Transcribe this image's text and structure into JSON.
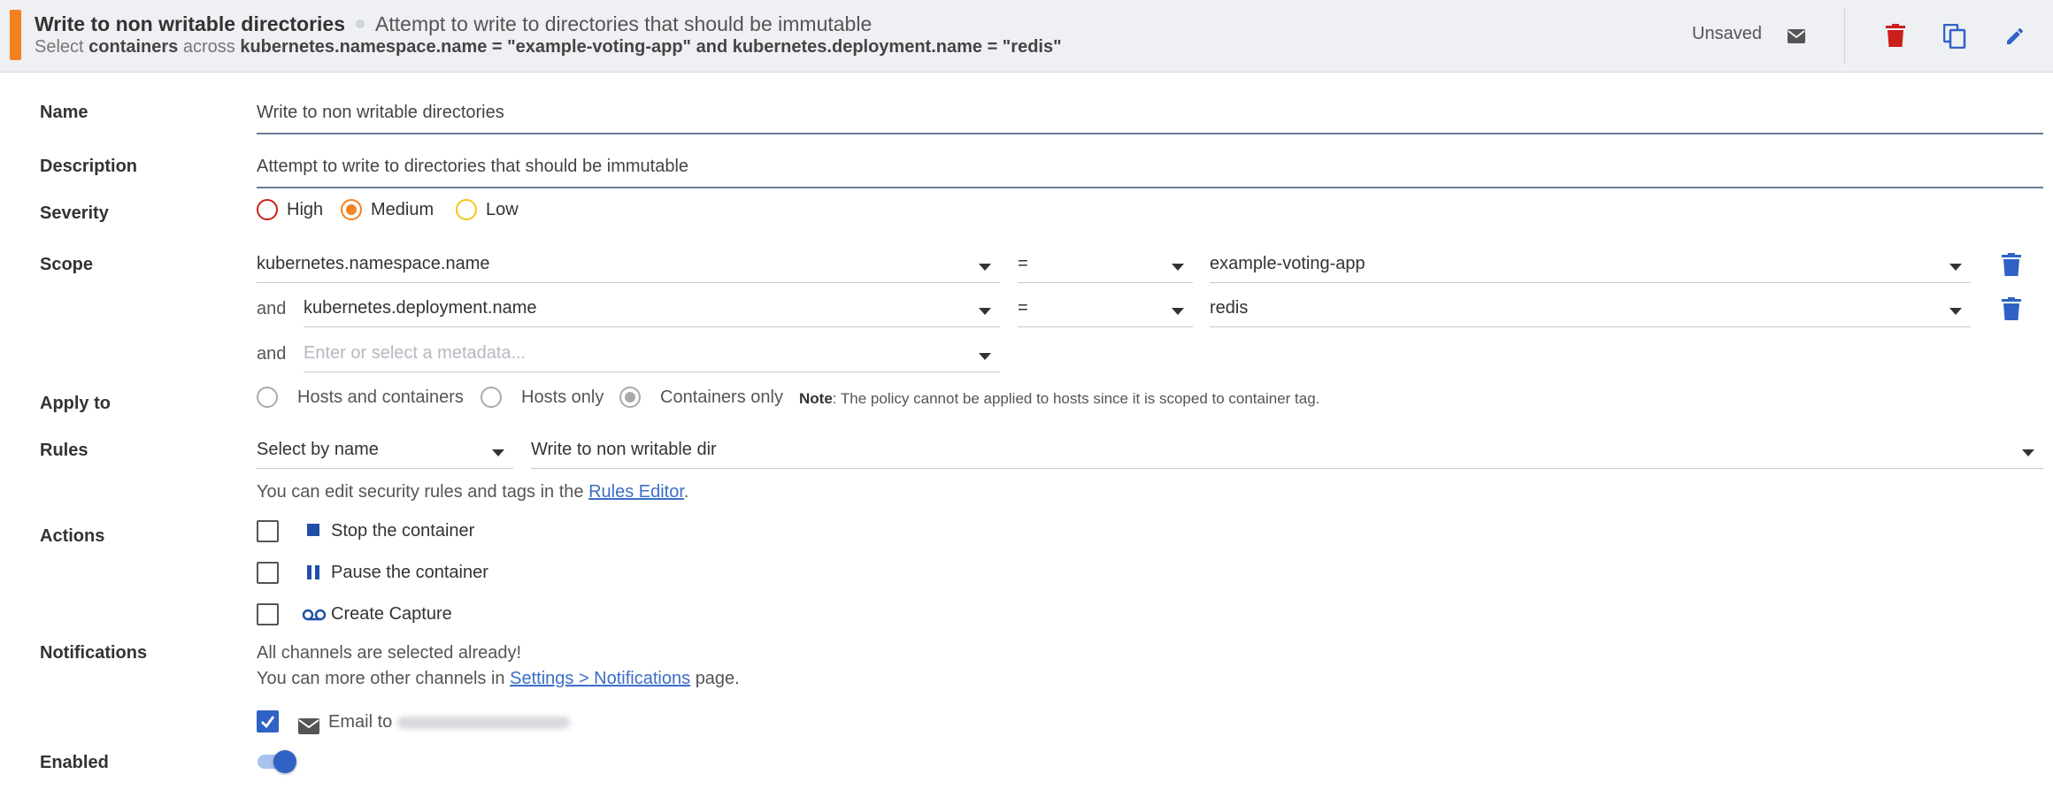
{
  "header": {
    "title": "Write to non writable directories",
    "description": "Attempt to write to directories that should be immutable",
    "subtitle": {
      "select": "Select",
      "target": "containers",
      "across": "across",
      "scope_expression": "kubernetes.namespace.name = \"example-voting-app\" and kubernetes.deployment.name = \"redis\""
    },
    "status": "Unsaved",
    "accent_color": "#f58220",
    "icons": {
      "email": "envelope-icon",
      "delete": "trash-icon",
      "duplicate": "copy-icon",
      "edit": "pencil-icon"
    }
  },
  "form": {
    "name": {
      "label": "Name",
      "value": "Write to non writable directories"
    },
    "description": {
      "label": "Description",
      "value": "Attempt to write to directories that should be immutable"
    },
    "severity": {
      "label": "Severity",
      "options": [
        {
          "label": "High",
          "color": "#cc1f1a",
          "selected": false
        },
        {
          "label": "Medium",
          "color": "#f58220",
          "selected": true
        },
        {
          "label": "Low",
          "color": "#f5c518",
          "selected": false
        }
      ]
    },
    "scope": {
      "label": "Scope",
      "conjunction": "and",
      "rows": [
        {
          "key": "kubernetes.namespace.name",
          "operator": "=",
          "value": "example-voting-app"
        },
        {
          "key": "kubernetes.deployment.name",
          "operator": "=",
          "value": "redis"
        }
      ],
      "new_row_placeholder": "Enter or select a metadata..."
    },
    "apply_to": {
      "label": "Apply to",
      "options": [
        {
          "label": "Hosts and containers",
          "selected": false
        },
        {
          "label": "Hosts only",
          "selected": false
        },
        {
          "label": "Containers only",
          "selected": true
        }
      ],
      "note_label": "Note",
      "note_text": ": The policy cannot be applied to hosts since it is scoped to container tag."
    },
    "rules": {
      "label": "Rules",
      "mode": "Select by name",
      "value": "Write to non writable dir",
      "help_prefix": "You can edit security rules and tags in the",
      "help_link": "Rules Editor",
      "help_suffix": "."
    },
    "actions": {
      "label": "Actions",
      "items": [
        {
          "label": "Stop the container",
          "icon": "stop-icon",
          "checked": false
        },
        {
          "label": "Pause the container",
          "icon": "pause-icon",
          "checked": false
        },
        {
          "label": "Create Capture",
          "icon": "capture-icon",
          "checked": false
        }
      ]
    },
    "notifications": {
      "label": "Notifications",
      "line1": "All channels are selected already!",
      "line2_prefix": "You can more other channels in",
      "line2_link": "Settings > Notifications",
      "line2_suffix": "page.",
      "channel_label": "Email to",
      "channel_checked": true
    },
    "enabled": {
      "label": "Enabled",
      "value": true
    }
  },
  "colors": {
    "primary": "#2f62c4",
    "danger": "#cc1f1a",
    "link": "#3b6ec6"
  }
}
